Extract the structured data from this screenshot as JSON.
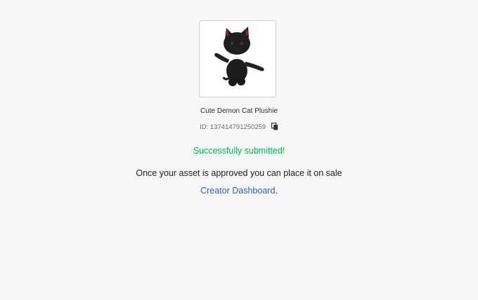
{
  "asset": {
    "name": "Cute Demon Cat Plushie",
    "id_label": "ID: 137414791250259",
    "thumbnail_icon": "black-demon-cat-plushie-image"
  },
  "status": {
    "success_message": "Successfully submitted!",
    "success_color": "#02b757"
  },
  "info": {
    "approval_text": "Once your asset is approved you can place it on sale",
    "dashboard_link_label": "Creator Dashboard",
    "dashboard_suffix": ".",
    "link_color": "#2f5db8"
  },
  "icons": {
    "copy": "copy-icon"
  }
}
